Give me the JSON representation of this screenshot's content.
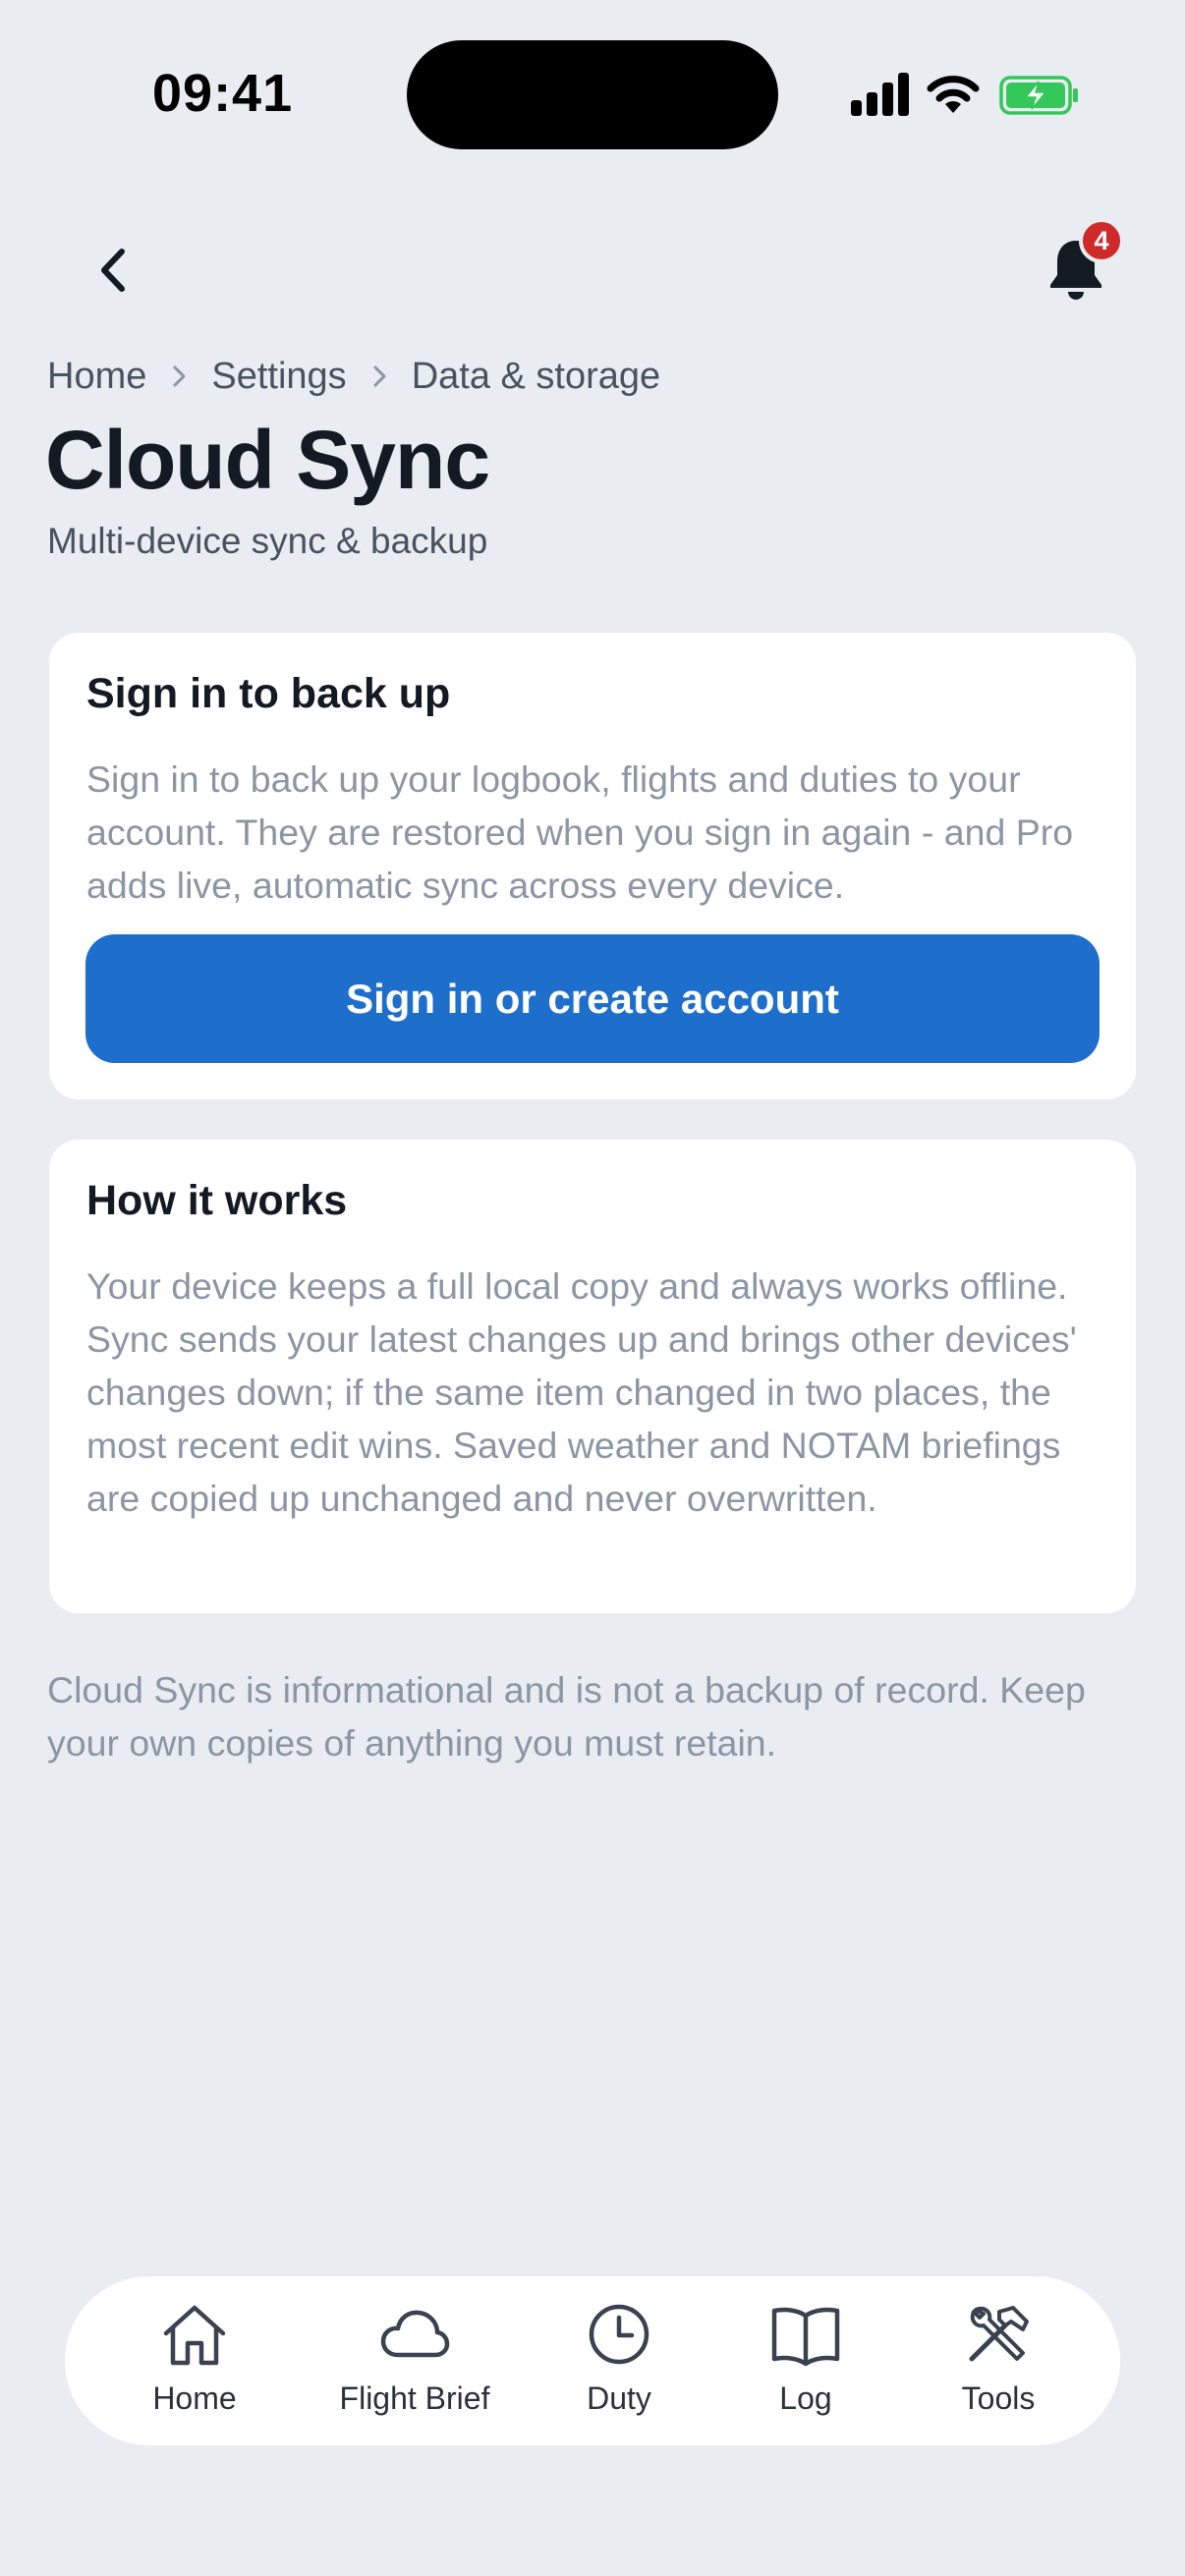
{
  "status_bar": {
    "time": "09:41",
    "icons": [
      "signal-icon",
      "wifi-icon",
      "battery-charging-icon"
    ]
  },
  "top_bar": {
    "back_icon": "chevron-left-icon",
    "notification_icon": "bell-icon",
    "notification_count": "4"
  },
  "breadcrumb": [
    "Home",
    "Settings",
    "Data & storage"
  ],
  "page": {
    "title": "Cloud Sync",
    "subtitle": "Multi-device sync & backup"
  },
  "signin_card": {
    "title": "Sign in to back up",
    "body": "Sign in to back up your logbook, flights and duties to your account. They are restored when you sign in again - and Pro adds live, automatic sync across every device.",
    "button_label": "Sign in or create account"
  },
  "how_card": {
    "title": "How it works",
    "body": "Your device keeps a full local copy and always works offline. Sync sends your latest changes up and brings other devices' changes down; if the same item changed in two places, the most recent edit wins. Saved weather and NOTAM briefings are copied up unchanged and never overwritten."
  },
  "disclaimer": "Cloud Sync is informational and is not a backup of record. Keep your own copies of anything you must retain.",
  "bottom_nav": {
    "items": [
      {
        "label": "Home",
        "icon": "home-icon"
      },
      {
        "label": "Flight Brief",
        "icon": "cloud-icon"
      },
      {
        "label": "Duty",
        "icon": "clock-icon"
      },
      {
        "label": "Log",
        "icon": "book-icon"
      },
      {
        "label": "Tools",
        "icon": "tools-icon"
      }
    ]
  },
  "colors": {
    "background": "#E9ECF1",
    "card": "#FFFFFF",
    "primary": "#1E6FCC",
    "badge": "#CF2A2A",
    "text_primary": "#141A24",
    "text_muted": "#8C95A4",
    "battery_green": "#34C759"
  }
}
